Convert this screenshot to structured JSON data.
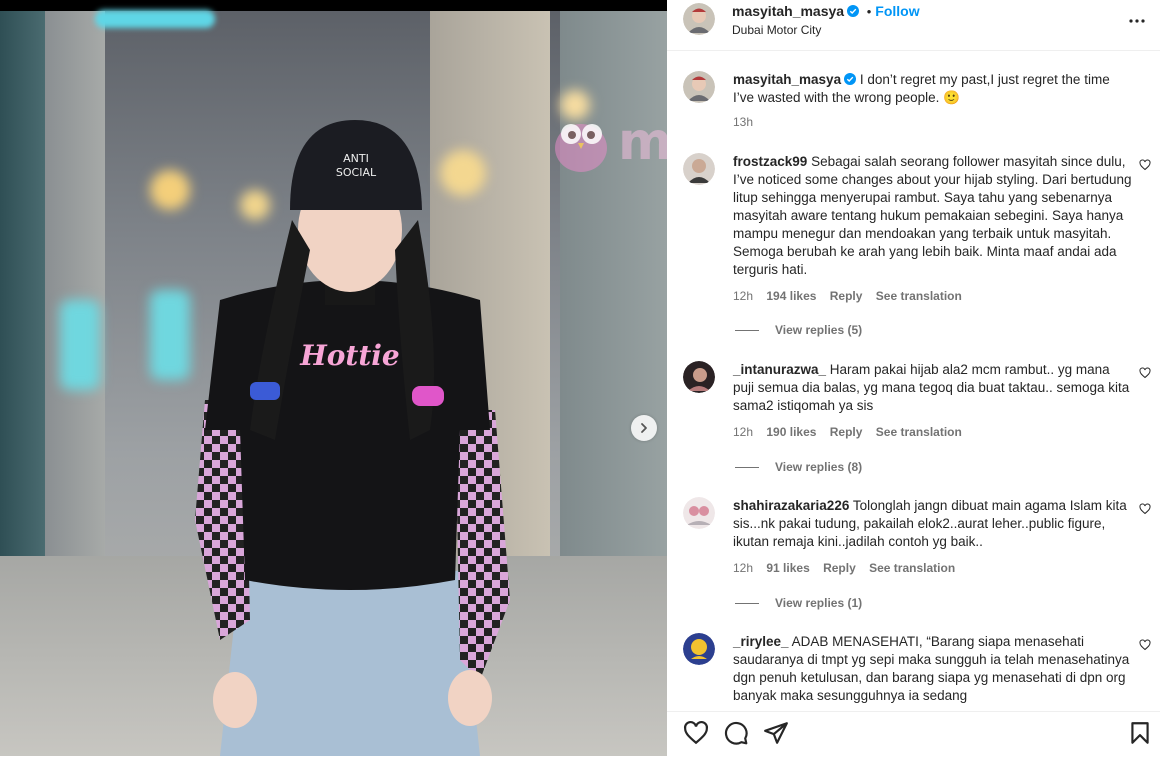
{
  "post": {
    "username": "masyitah_masya",
    "follow_label": "Follow",
    "location": "Dubai Motor City",
    "caption": "I don’t regret my past,I just regret the time I’ve wasted with the wrong people. 🙂",
    "caption_time": "13h",
    "watermark": "murai"
  },
  "comments": [
    {
      "username": "frostzack99",
      "text": "Sebagai salah seorang follower masyitah since dulu, I’ve noticed some changes about your hijab styling. Dari bertudung litup sehingga menyerupai rambut. Saya tahu yang sebenarnya masyitah aware tentang hukum pemakaian sebegini. Saya hanya mampu menegur dan mendoakan yang terbaik untuk masyitah. Semoga berubah ke arah yang lebih baik. Minta maaf andai ada terguris hati.",
      "time": "12h",
      "likes": "194 likes",
      "reply": "Reply",
      "translate": "See translation",
      "view_replies": "View replies (5)"
    },
    {
      "username": "_intanurazwa_",
      "text": "Haram pakai hijab ala2 mcm rambut.. yg mana puji semua dia balas, yg mana tegoq dia buat taktau.. semoga kita sama2 istiqomah ya sis",
      "time": "12h",
      "likes": "190 likes",
      "reply": "Reply",
      "translate": "See translation",
      "view_replies": "View replies (8)"
    },
    {
      "username": "shahirazakaria226",
      "text": "Tolonglah jangn dibuat main agama Islam kita sis...nk pakai tudung, pakailah elok2..aurat leher..public figure, ikutan remaja kini..jadilah contoh yg baik..",
      "time": "12h",
      "likes": "91 likes",
      "reply": "Reply",
      "translate": "See translation",
      "view_replies": "View replies (1)"
    },
    {
      "username": "_rirylee_",
      "text": "ADAB MENASEHATI, “Barang siapa menasehati saudaranya di tmpt yg sepi maka sungguh ia telah menasehatinya dgn penuh ketulusan, dan barang siapa yg menasehati di dpn org banyak maka sesungguhnya ia sedang"
    }
  ],
  "icons": {
    "like": "heart-icon",
    "comment": "comment-icon",
    "share": "send-icon",
    "save": "bookmark-icon",
    "more": "more-options-icon",
    "next": "chevron-right-icon",
    "verified": "verified-badge-icon"
  },
  "colors": {
    "accent": "#0095f6",
    "text": "#262626",
    "muted": "#737373"
  }
}
